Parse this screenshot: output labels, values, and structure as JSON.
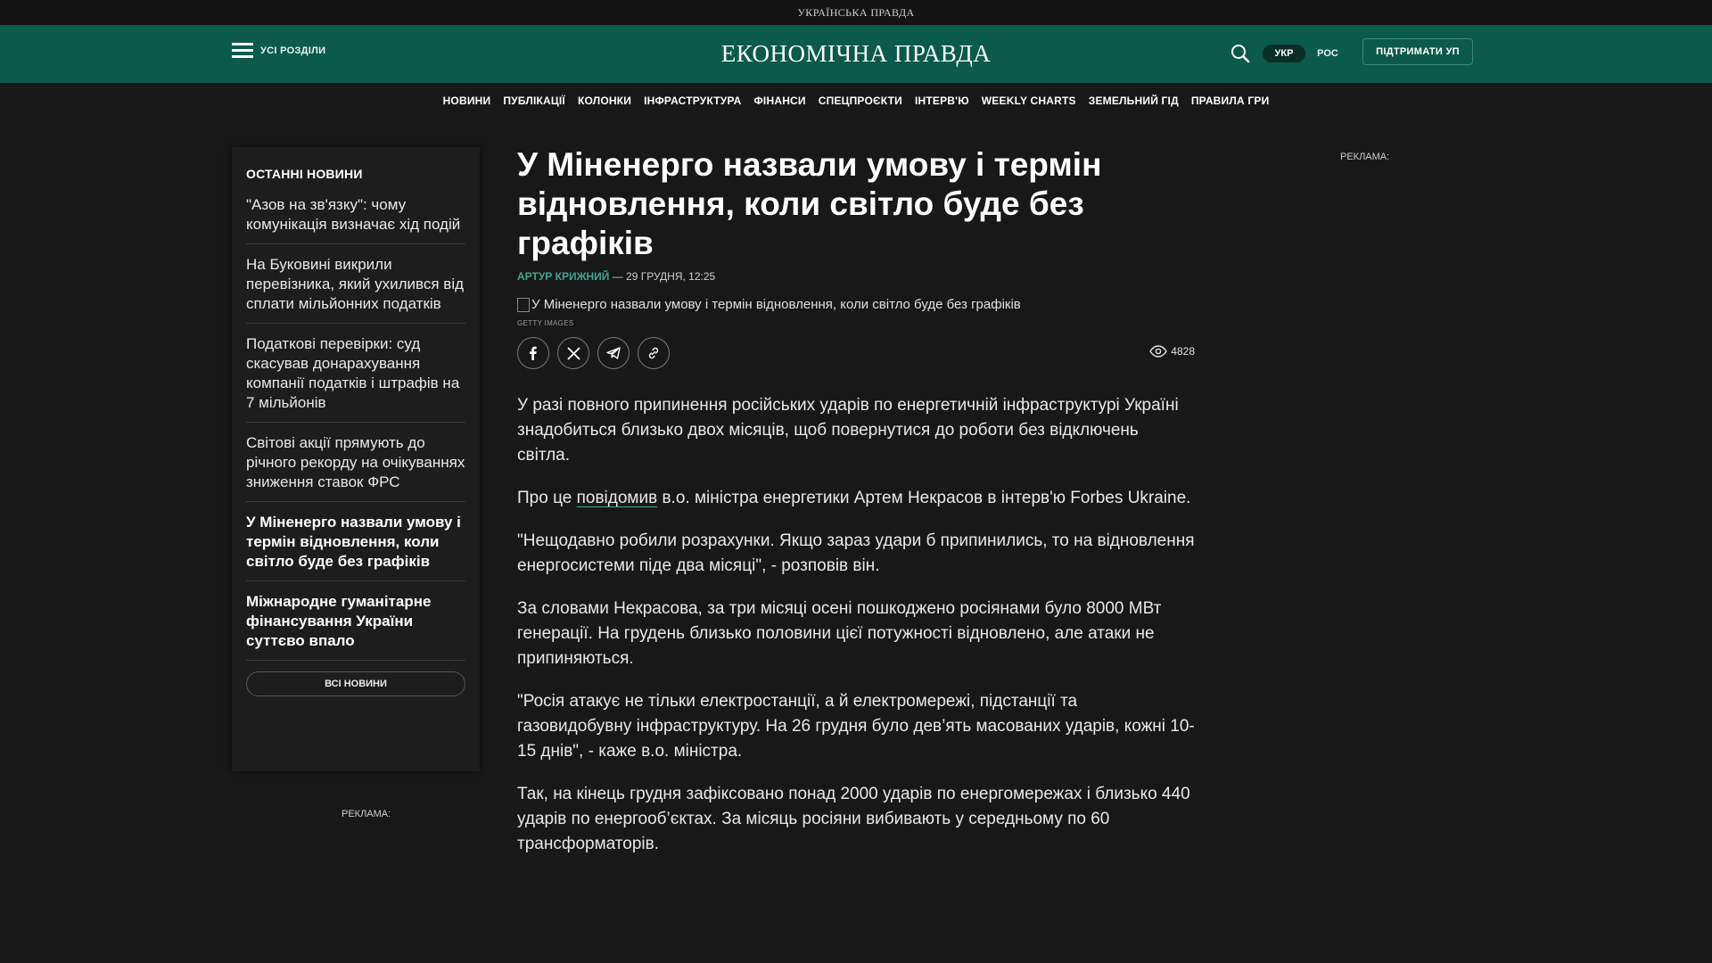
{
  "top_brand": "УКРАЇНСЬКА ПРАВДА",
  "header": {
    "menu_label": "УСІ РОЗДІЛИ",
    "logo": "ЕКОНОМІЧНА ПРАВДА",
    "lang_active": "УКР",
    "lang_other": "РОС",
    "support": "ПІДТРИМАТИ УП",
    "search_icon": "search-icon",
    "accent_color": "#0c5a4a"
  },
  "nav": [
    "НОВИНИ",
    "ПУБЛІКАЦІЇ",
    "КОЛОНКИ",
    "ІНФРАСТРУКТУРА",
    "ФІНАНСИ",
    "СПЕЦПРОЄКТИ",
    "ІНТЕРВ'Ю",
    "WEEKLY CHARTS",
    "ЗЕМЕЛЬНИЙ ГІД",
    "ПРАВИЛА ГРИ"
  ],
  "sidebar": {
    "title": "ОСТАННІ НОВИНИ",
    "items": [
      {
        "text": "\"Азов на зв'язку\": чому комунікація визначає хід подій",
        "bold": false
      },
      {
        "text": "На Буковині викрили перевізника, який ухилився від сплати мільйонних податків",
        "bold": false
      },
      {
        "text": "Податкові перевірки: суд скасував донарахування компанії податків і штрафів на 7 мільйонів",
        "bold": false
      },
      {
        "text": "Світові акції прямують до річного рекорду на очікуваннях зниження ставок ФРС",
        "bold": false
      },
      {
        "text": "У Міненерго назвали умову і термін відновлення, коли світло буде без графіків",
        "bold": true
      },
      {
        "text": "Міжнародне гуманітарне фінансування України суттєво впало",
        "bold": true
      }
    ],
    "all_news": "ВСІ НОВИНИ"
  },
  "ad_label_left": "РЕКЛАМА:",
  "ad_label_right": "РЕКЛАМА:",
  "article": {
    "title": "У Міненерго назвали умову і термін відновлення, коли світло буде без графіків",
    "author": "АРТУР КРИЖНИЙ",
    "date": " — 29 ГРУДНЯ, 12:25",
    "image_alt": "У Міненерго назвали умову і термін відновлення, коли світло буде без графіків",
    "image_credit": "GETTY IMAGES",
    "views": "4828",
    "share_icons": [
      "facebook-icon",
      "x-icon",
      "telegram-icon",
      "link-icon"
    ],
    "p1": "У разі повного припинення російських ударів по енергетичній інфраструктурі Україні знадобиться близько двох місяців, щоб повернутися до роботи без відключень світла.",
    "p2_before": "Про це ",
    "p2_link": "повідомив",
    "p2_after": " в.о. міністра енергетики Артем Некрасов в інтерв'ю Forbes Ukraine.",
    "p3": "\"Нещодавно робили розрахунки. Якщо зараз удари б припинились, то на відновлення енергосистеми піде два місяці\", - розповів він.",
    "p4": "За словами Некрасова, за три місяці осені пошкоджено росіянами було 8000 МВт генерації. На грудень близько половини цієї потужності відновлено, але атаки не припиняються.",
    "p5": "\"Росія атакує не тільки електростанції, а й електромережі, підстанції та газовидобувну інфраструктуру. На 26 грудня було дев’ять масованих ударів, кожні 10-15 днів\", - каже в.о. міністра.",
    "p6": "Так, на кінець грудня зафіксовано понад 2000 ударів по енергомережах і близько 440 ударів по енергооб’єктах. За місяць росіяни вибивають у середньому по 60 трансформаторів."
  }
}
